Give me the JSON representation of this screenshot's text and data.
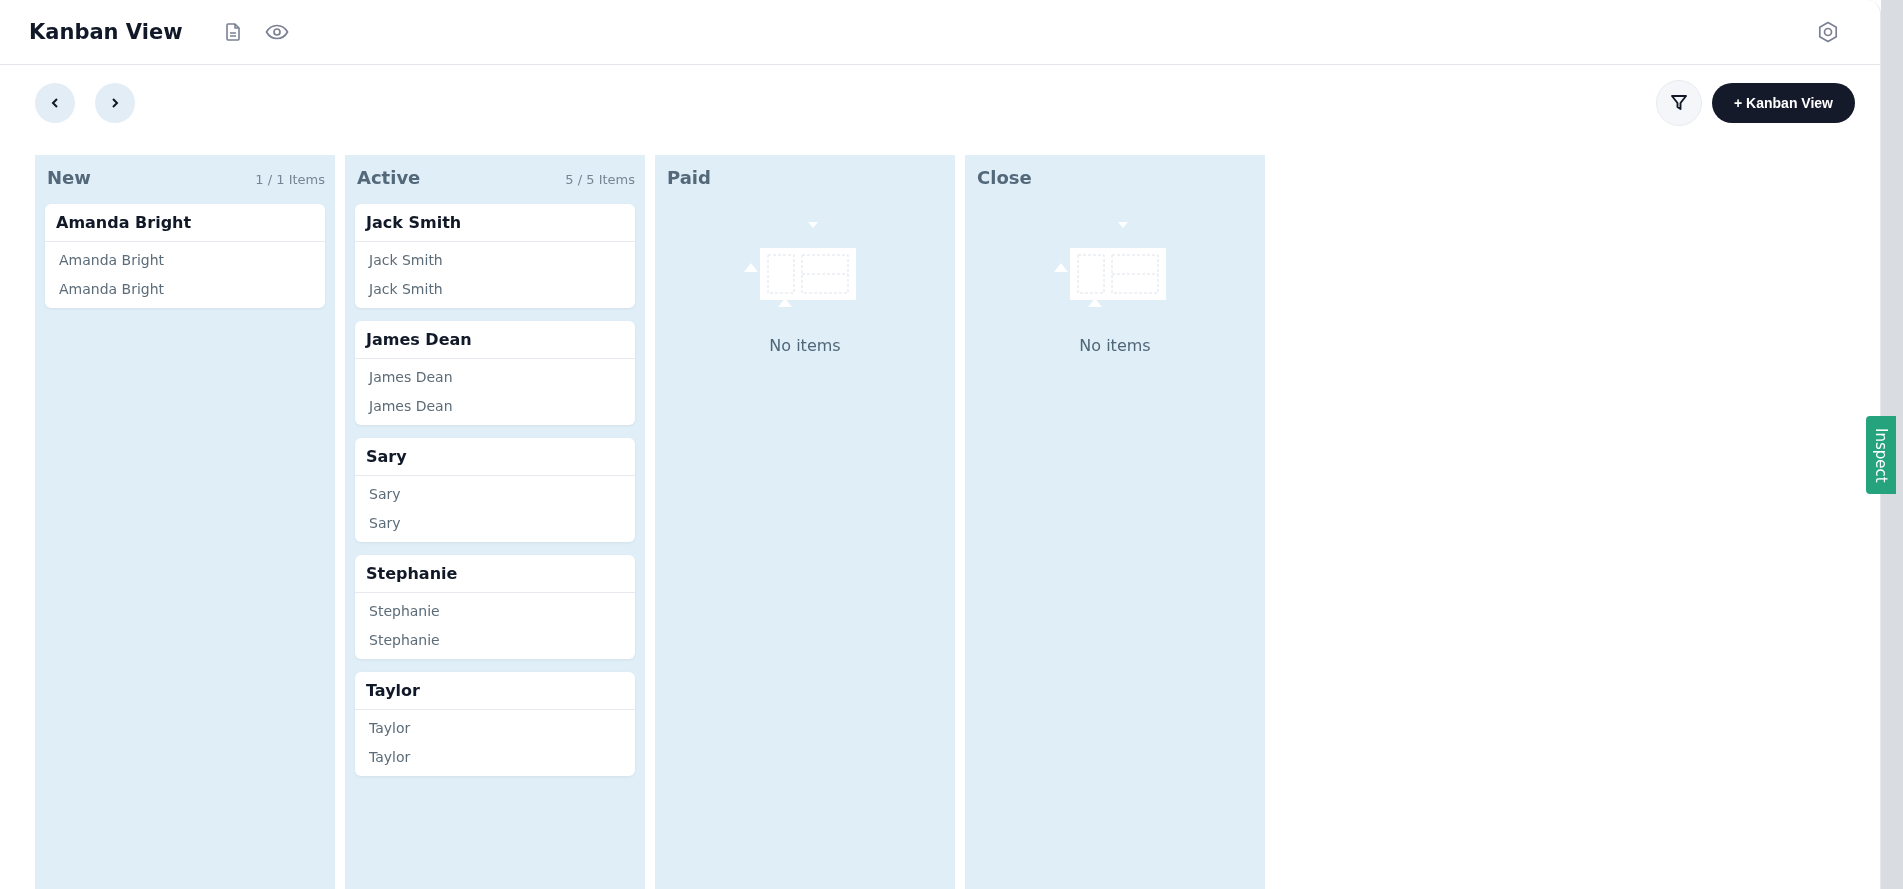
{
  "header": {
    "title": "Kanban View"
  },
  "toolbar": {
    "add_button": "+ Kanban View"
  },
  "columns": [
    {
      "title": "New",
      "count": "1 / 1 Items",
      "cards": [
        {
          "title": "Amanda Bright",
          "lines": [
            "Amanda Bright",
            "Amanda Bright"
          ]
        }
      ]
    },
    {
      "title": "Active",
      "count": "5 / 5 Items",
      "cards": [
        {
          "title": "Jack Smith",
          "lines": [
            "Jack Smith",
            "Jack Smith"
          ]
        },
        {
          "title": "James Dean",
          "lines": [
            "James Dean",
            "James Dean"
          ]
        },
        {
          "title": "Sary",
          "lines": [
            "Sary",
            "Sary"
          ]
        },
        {
          "title": "Stephanie",
          "lines": [
            "Stephanie",
            "Stephanie"
          ]
        },
        {
          "title": "Taylor",
          "lines": [
            "Taylor",
            "Taylor"
          ]
        }
      ]
    },
    {
      "title": "Paid",
      "empty_text": "No items"
    },
    {
      "title": "Close",
      "empty_text": "No items"
    }
  ],
  "side_tab": {
    "label": "Inspect"
  }
}
